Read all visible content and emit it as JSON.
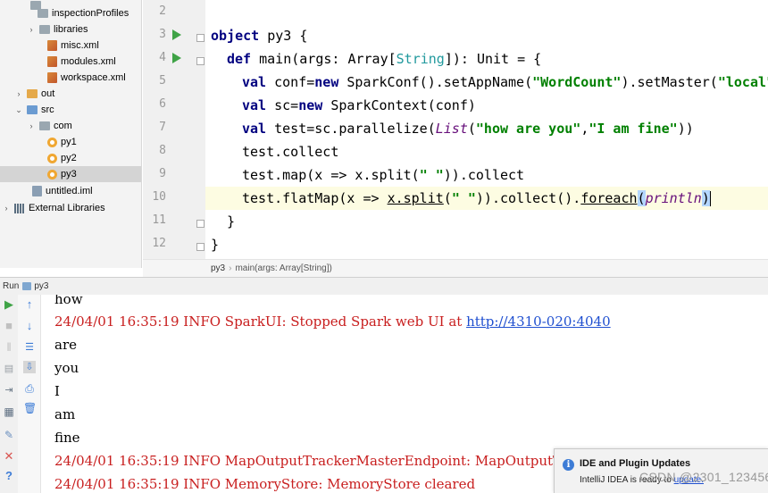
{
  "project_tree": {
    "items": [
      {
        "label": "inspectionProfiles",
        "icon": "folder-icon",
        "arrow": ""
      },
      {
        "label": "libraries",
        "icon": "folder-icon",
        "arrow": "›"
      },
      {
        "label": "misc.xml",
        "icon": "xml-file-icon",
        "arrow": ""
      },
      {
        "label": "modules.xml",
        "icon": "xml-file-icon",
        "arrow": ""
      },
      {
        "label": "workspace.xml",
        "icon": "xml-file-icon",
        "arrow": ""
      },
      {
        "label": "out",
        "icon": "output-folder-icon",
        "arrow": "›"
      },
      {
        "label": "src",
        "icon": "source-folder-icon",
        "arrow": "⌄"
      },
      {
        "label": "com",
        "icon": "package-icon",
        "arrow": "›"
      },
      {
        "label": "py1",
        "icon": "scala-object-icon",
        "arrow": ""
      },
      {
        "label": "py2",
        "icon": "scala-object-icon",
        "arrow": ""
      },
      {
        "label": "py3",
        "icon": "scala-object-icon",
        "arrow": ""
      },
      {
        "label": "untitled.iml",
        "icon": "iml-file-icon",
        "arrow": ""
      },
      {
        "label": "External Libraries",
        "icon": "library-icon",
        "arrow": "›"
      }
    ],
    "selected": "py3"
  },
  "editor": {
    "line_numbers": [
      "2",
      "3",
      "4",
      "5",
      "6",
      "7",
      "8",
      "9",
      "10",
      "11",
      "12"
    ],
    "lines": {
      "l3_kw": "object",
      "l3_rest": " py3 {",
      "l4_kw": "def",
      "l4_a": " main(args: Array[",
      "l4_type": "String",
      "l4_b": "]): Unit = {",
      "l5_kw1": "val",
      "l5_a": " conf=",
      "l5_kw2": "new",
      "l5_b": " SparkConf().setAppName(",
      "l5_s1": "\"WordCount\"",
      "l5_c": ").setMaster(",
      "l5_s2": "\"local\"",
      "l6_kw1": "val",
      "l6_a": " sc=",
      "l6_kw2": "new",
      "l6_b": " SparkContext(conf)",
      "l7_kw": "val",
      "l7_a": " test=sc.parallelize(",
      "l7_it": "List",
      "l7_b": "(",
      "l7_s1": "\"how are you\"",
      "l7_c": ",",
      "l7_s2": "\"I am fine\"",
      "l7_d": "))",
      "l8": "test.collect",
      "l9_a": "test.map(x => x.split(",
      "l9_s": "\" \"",
      "l9_b": ")).collect",
      "l10_a": "test.flatMap(x => ",
      "l10_ul": "x.split",
      "l10_b": "(",
      "l10_s": "\" \"",
      "l10_c": ")).collect().",
      "l10_ul2": "foreach",
      "l10_br1": "(",
      "l10_it": "println",
      "l10_br2": ")",
      "l11": "}",
      "l12": "}"
    }
  },
  "breadcrumb": {
    "file": "py3",
    "separator": "›",
    "method": "main(args: Array[String])"
  },
  "run_window": {
    "label": "Run",
    "tab": "py3"
  },
  "console": {
    "lines": [
      {
        "text": "how",
        "type": "plain"
      },
      {
        "text": "24/04/01 16:35:19 INFO SparkUI: Stopped Spark web UI at ",
        "type": "log",
        "link": "http://4310-020:4040"
      },
      {
        "text": "are",
        "type": "plain"
      },
      {
        "text": "you",
        "type": "plain"
      },
      {
        "text": "I",
        "type": "plain"
      },
      {
        "text": "am",
        "type": "plain"
      },
      {
        "text": "fine",
        "type": "plain"
      },
      {
        "text": "24/04/01 16:35:19 INFO MapOutputTrackerMasterEndpoint: MapOutputT",
        "type": "log"
      },
      {
        "text": "24/04/01 16:35:19 INFO MemoryStore: MemoryStore cleared",
        "type": "log"
      }
    ]
  },
  "notification": {
    "title": "IDE and Plugin Updates",
    "body": "IntelliJ IDEA is ready to ",
    "link": "update."
  },
  "watermark": "CSDN @2301_123456",
  "colors": {
    "keyword": "#000080",
    "string": "#008000",
    "log_text": "#c81e1e",
    "link": "#1f4fd0",
    "run_green": "#3fa346"
  }
}
